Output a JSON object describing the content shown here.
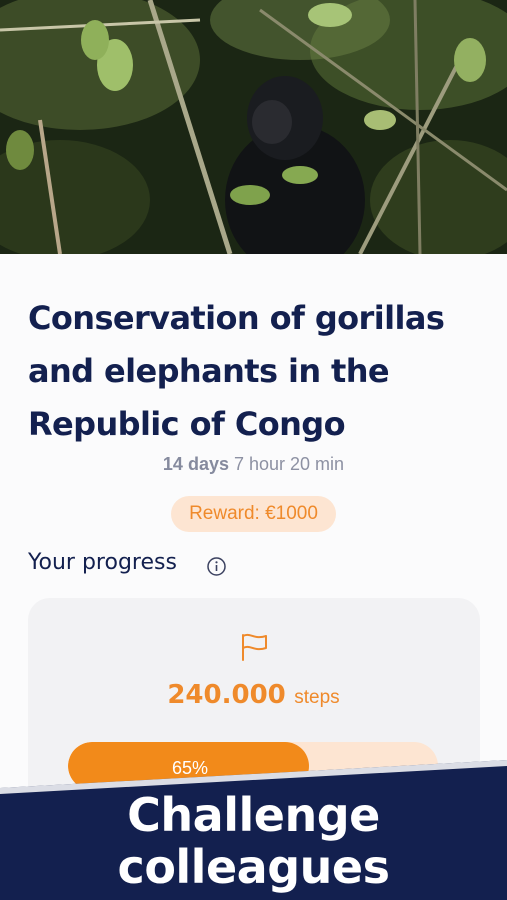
{
  "hero": {
    "image": "gorilla-in-forest-photo"
  },
  "challenge": {
    "title": "Conservation of gorillas and elephants in the Republic of Congo",
    "duration_days": "14 days",
    "duration_rest": "7 hour 20 min",
    "reward": "Reward: €1000"
  },
  "progress": {
    "label": "Your progress",
    "info_icon": "info-icon",
    "flag_icon": "flag-icon",
    "steps_value": "240.000",
    "steps_unit": "steps",
    "percent_label": "65%",
    "percent": 65
  },
  "banner": {
    "line1": "Challenge",
    "line2": "colleagues"
  },
  "colors": {
    "navy": "#13204f",
    "orange": "#f28a1a",
    "orange_light": "#fde5d2",
    "banner": "#13204f"
  }
}
